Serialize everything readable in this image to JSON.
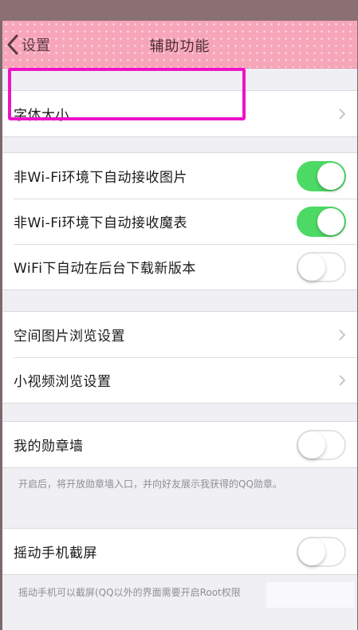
{
  "nav": {
    "back_label": "设置",
    "title": "辅助功能"
  },
  "groups": [
    {
      "rows": [
        {
          "label": "字体大小",
          "type": "chevron"
        }
      ]
    },
    {
      "rows": [
        {
          "label": "非Wi-Fi环境下自动接收图片",
          "type": "toggle",
          "on": true
        },
        {
          "label": "非Wi-Fi环境下自动接收魔表",
          "type": "toggle",
          "on": true
        },
        {
          "label": "WiFi下自动在后台下载新版本",
          "type": "toggle",
          "on": false
        }
      ]
    },
    {
      "rows": [
        {
          "label": "空间图片浏览设置",
          "type": "chevron"
        },
        {
          "label": "小视频浏览设置",
          "type": "chevron"
        }
      ]
    },
    {
      "rows": [
        {
          "label": "我的勋章墙",
          "type": "toggle",
          "on": false
        }
      ]
    },
    {
      "rows": [
        {
          "label": "摇动手机截屏",
          "type": "toggle",
          "on": false
        }
      ]
    }
  ],
  "footnotes": {
    "medal_wall": "开启后，将开放勋章墙入口，并向好友展示我获得的QQ勋章。",
    "shake_screenshot": "摇动手机可以截屏(QQ以外的界面需要开启Root权限"
  },
  "colors": {
    "nav_pink": "#f7a6ba",
    "toggle_on": "#4cd964",
    "highlight_magenta": "#ee12c8"
  }
}
